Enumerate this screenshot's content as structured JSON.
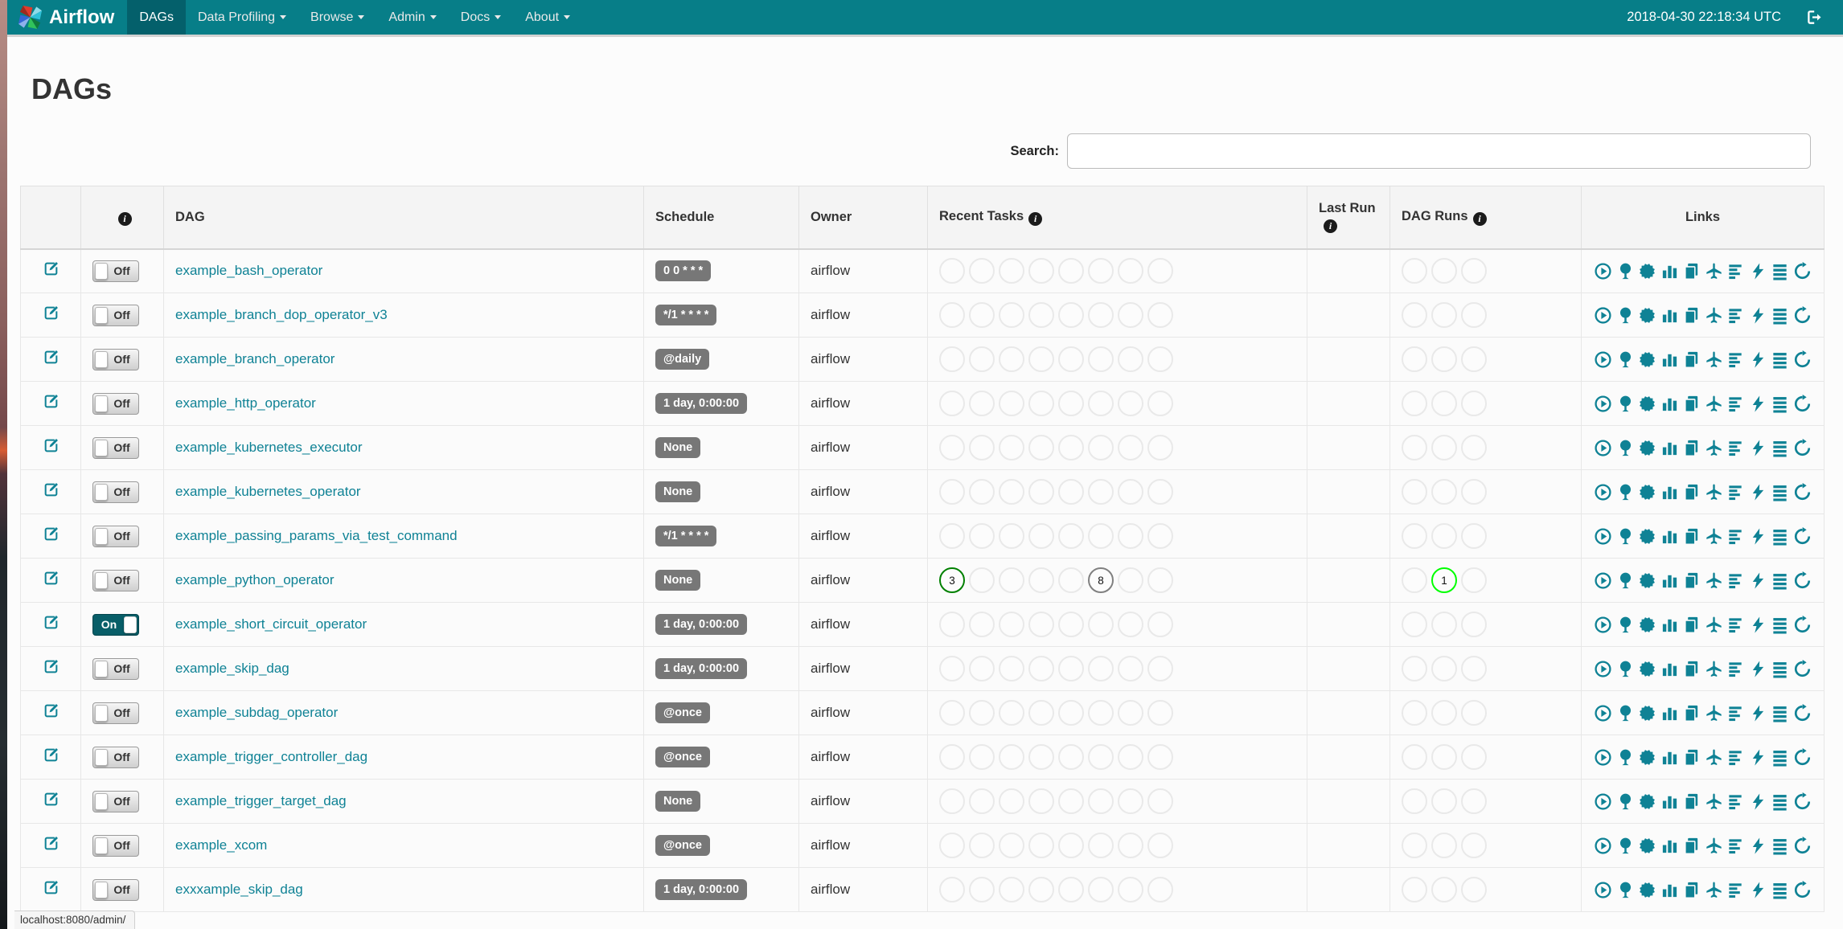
{
  "navbar": {
    "brand": "Airflow",
    "items": [
      {
        "label": "DAGs",
        "active": true,
        "caret": false
      },
      {
        "label": "Data Profiling",
        "active": false,
        "caret": true
      },
      {
        "label": "Browse",
        "active": false,
        "caret": true
      },
      {
        "label": "Admin",
        "active": false,
        "caret": true
      },
      {
        "label": "Docs",
        "active": false,
        "caret": true
      },
      {
        "label": "About",
        "active": false,
        "caret": true
      }
    ],
    "clock": "2018-04-30 22:18:34 UTC"
  },
  "page_title": "DAGs",
  "search": {
    "label": "Search:",
    "value": ""
  },
  "toggle": {
    "on": "On",
    "off": "Off"
  },
  "colors": {
    "navbar": "#077E88",
    "navbar_active": "#04606B",
    "accent": "#0F8295",
    "badge": "#777777"
  },
  "table": {
    "headers": {
      "dag": "DAG",
      "schedule": "Schedule",
      "owner": "Owner",
      "recent_tasks": "Recent Tasks",
      "last_run": "Last Run",
      "dag_runs": "DAG Runs",
      "links": "Links"
    },
    "recent_task_slots": 8,
    "dag_run_slots": 3,
    "state_colors": {
      "success": "#008000",
      "running": "#00ff00",
      "queued": "#808080"
    },
    "links": [
      "trigger-dag",
      "tree-view",
      "graph-view",
      "task-duration",
      "task-tries",
      "landing-times",
      "gantt",
      "code",
      "dag-details",
      "refresh"
    ],
    "rows": [
      {
        "name": "example_bash_operator",
        "schedule": "0 0 * * *",
        "owner": "airflow",
        "enabled": false,
        "last_run": "",
        "recent_tasks": [],
        "dag_runs": []
      },
      {
        "name": "example_branch_dop_operator_v3",
        "schedule": "*/1 * * * *",
        "owner": "airflow",
        "enabled": false,
        "last_run": "",
        "recent_tasks": [],
        "dag_runs": []
      },
      {
        "name": "example_branch_operator",
        "schedule": "@daily",
        "owner": "airflow",
        "enabled": false,
        "last_run": "",
        "recent_tasks": [],
        "dag_runs": []
      },
      {
        "name": "example_http_operator",
        "schedule": "1 day, 0:00:00",
        "owner": "airflow",
        "enabled": false,
        "last_run": "",
        "recent_tasks": [],
        "dag_runs": []
      },
      {
        "name": "example_kubernetes_executor",
        "schedule": "None",
        "owner": "airflow",
        "enabled": false,
        "last_run": "",
        "recent_tasks": [],
        "dag_runs": []
      },
      {
        "name": "example_kubernetes_operator",
        "schedule": "None",
        "owner": "airflow",
        "enabled": false,
        "last_run": "",
        "recent_tasks": [],
        "dag_runs": []
      },
      {
        "name": "example_passing_params_via_test_command",
        "schedule": "*/1 * * * *",
        "owner": "airflow",
        "enabled": false,
        "last_run": "",
        "recent_tasks": [],
        "dag_runs": []
      },
      {
        "name": "example_python_operator",
        "schedule": "None",
        "owner": "airflow",
        "enabled": false,
        "last_run": "",
        "recent_tasks": [
          {
            "slot": 1,
            "count": 3,
            "state": "success"
          },
          {
            "slot": 6,
            "count": 8,
            "state": "queued"
          }
        ],
        "dag_runs": [
          {
            "slot": 2,
            "count": 1,
            "state": "running"
          }
        ]
      },
      {
        "name": "example_short_circuit_operator",
        "schedule": "1 day, 0:00:00",
        "owner": "airflow",
        "enabled": true,
        "last_run": "",
        "recent_tasks": [],
        "dag_runs": []
      },
      {
        "name": "example_skip_dag",
        "schedule": "1 day, 0:00:00",
        "owner": "airflow",
        "enabled": false,
        "last_run": "",
        "recent_tasks": [],
        "dag_runs": []
      },
      {
        "name": "example_subdag_operator",
        "schedule": "@once",
        "owner": "airflow",
        "enabled": false,
        "last_run": "",
        "recent_tasks": [],
        "dag_runs": []
      },
      {
        "name": "example_trigger_controller_dag",
        "schedule": "@once",
        "owner": "airflow",
        "enabled": false,
        "last_run": "",
        "recent_tasks": [],
        "dag_runs": []
      },
      {
        "name": "example_trigger_target_dag",
        "schedule": "None",
        "owner": "airflow",
        "enabled": false,
        "last_run": "",
        "recent_tasks": [],
        "dag_runs": []
      },
      {
        "name": "example_xcom",
        "schedule": "@once",
        "owner": "airflow",
        "enabled": false,
        "last_run": "",
        "recent_tasks": [],
        "dag_runs": []
      },
      {
        "name": "exxxample_skip_dag",
        "schedule": "1 day, 0:00:00",
        "owner": "airflow",
        "enabled": false,
        "last_run": "",
        "recent_tasks": [],
        "dag_runs": []
      }
    ]
  },
  "statusbar": {
    "url": "localhost:8080/admin/"
  }
}
